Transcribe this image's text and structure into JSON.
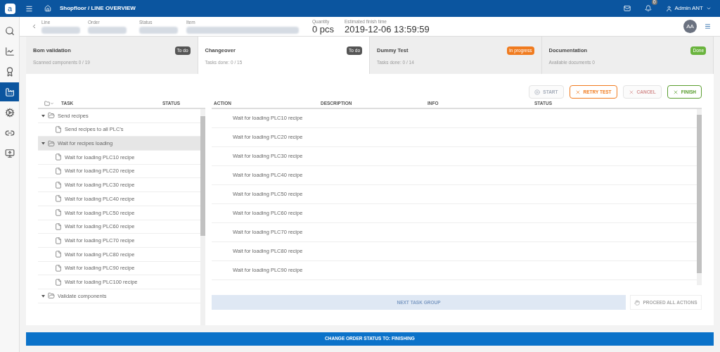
{
  "topbar": {
    "logo": "a",
    "breadcrumb": "Shopfloor / LINE OVERVIEW",
    "notifications": "0",
    "user": "Admin ANT"
  },
  "sidebar": [
    {
      "selected": false
    },
    {
      "selected": false
    },
    {
      "selected": false
    },
    {
      "selected": true
    },
    {
      "selected": false
    },
    {
      "selected": false
    },
    {
      "selected": false
    }
  ],
  "info": {
    "fields": [
      {
        "label": "Line",
        "kind": "blurred"
      },
      {
        "label": "Order",
        "kind": "blurred"
      },
      {
        "label": "Status",
        "kind": "blurred"
      },
      {
        "label": "Item",
        "kind": "blurred"
      },
      {
        "label": "Quantity",
        "kind": "text",
        "value": "0 pcs"
      },
      {
        "label": "Estimated finish time",
        "kind": "text",
        "value": "2019-12-06 13:59:59"
      }
    ],
    "avatar": "AA"
  },
  "stages": [
    {
      "title": "Bom validation",
      "badge": "To do",
      "color": "#555555",
      "subtitle": "Scanned components 0 / 19",
      "selected": false
    },
    {
      "title": "Changeover",
      "badge": "To do",
      "color": "#555555",
      "subtitle": "Tasks done: 0 / 15",
      "selected": true
    },
    {
      "title": "Dummy Test",
      "badge": "In progress",
      "color": "#f07b1f",
      "subtitle": "Tasks done: 0 / 14",
      "selected": false
    },
    {
      "title": "Documentation",
      "badge": "Done",
      "color": "#6ab43e",
      "subtitle": "Available documents 0",
      "selected": false
    }
  ],
  "actions": [
    {
      "label": "START",
      "kind": "start",
      "color": "#a3abb8",
      "disabled": true
    },
    {
      "label": "RETRY TEST",
      "kind": "close",
      "color": "#f07b1f",
      "disabled": false
    },
    {
      "label": "CANCEL",
      "kind": "close",
      "color": "#d49090",
      "disabled": true
    },
    {
      "label": "FINISH",
      "kind": "close",
      "color": "#5a9e2f",
      "disabled": false
    }
  ],
  "tree": {
    "columns": [
      "TASK",
      "STATUS"
    ],
    "items": [
      {
        "label": "Send recipes",
        "expanded": true,
        "selected": false,
        "children": [
          {
            "label": "Send recipes to all PLC's",
            "selected": false
          }
        ]
      },
      {
        "label": "Wait for recipes loading",
        "expanded": true,
        "selected": true,
        "children": [
          {
            "label": "Wait for loading PLC10 recipe",
            "selected": false
          },
          {
            "label": "Wait for loading PLC20 recipe",
            "selected": false
          },
          {
            "label": "Wait for loading PLC30 recipe",
            "selected": false
          },
          {
            "label": "Wait for loading PLC40 recipe",
            "selected": false
          },
          {
            "label": "Wait for loading PLC50 recipe",
            "selected": false
          },
          {
            "label": "Wait for loading PLC60 recipe",
            "selected": false
          },
          {
            "label": "Wait for loading PLC70 recipe",
            "selected": false
          },
          {
            "label": "Wait for loading PLC80 recipe",
            "selected": false
          },
          {
            "label": "Wait for loading PLC90 recipe",
            "selected": false
          },
          {
            "label": "Wait for loading PLC100 recipe",
            "selected": false
          }
        ]
      },
      {
        "label": "Validate components",
        "expanded": true,
        "selected": false
      }
    ]
  },
  "action_table": {
    "columns": [
      "ACTION",
      "DESCRIPTION",
      "INFO",
      "STATUS"
    ],
    "rows": [
      {
        "action": "Wait for loading PLC10 recipe"
      },
      {
        "action": "Wait for loading PLC20 recipe"
      },
      {
        "action": "Wait for loading PLC30 recipe"
      },
      {
        "action": "Wait for loading PLC40 recipe"
      },
      {
        "action": "Wait for loading PLC50 recipe"
      },
      {
        "action": "Wait for loading PLC60 recipe"
      },
      {
        "action": "Wait for loading PLC70 recipe"
      },
      {
        "action": "Wait for loading PLC80 recipe"
      },
      {
        "action": "Wait for loading PLC90 recipe"
      }
    ]
  },
  "next_button": {
    "label": "NEXT TASK GROUP",
    "disabled": true
  },
  "proceed_button": {
    "label": "PROCEED ALL ACTIONS",
    "disabled": true
  },
  "status_button": {
    "label": "CHANGE ORDER STATUS TO: FINISHING"
  }
}
